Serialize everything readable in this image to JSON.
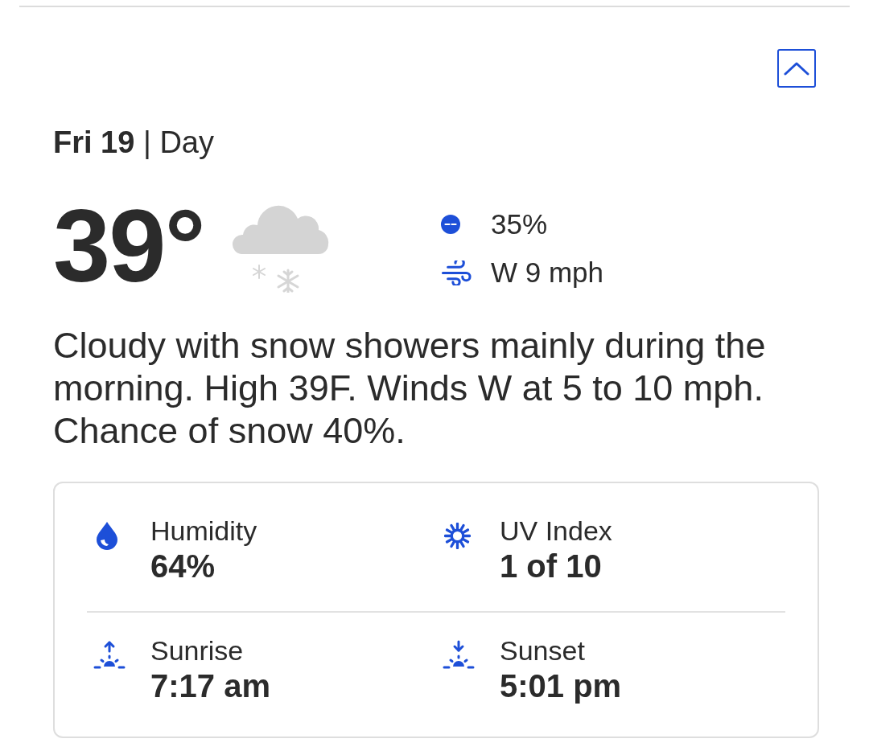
{
  "collapse_button": {
    "expanded": true
  },
  "header": {
    "title": "**Fri 19** | Day"
  },
  "current": {
    "temperature": "39°"
  },
  "stats": [
    {
      "kind": "precipitation",
      "value": "35%"
    },
    {
      "kind": "wind",
      "value": "W 9 mph"
    }
  ],
  "description": "Cloudy with snow showers mainly during the morning. High 39F. Winds W at 5 to 10 mph. Chance of snow 40%.",
  "details": [
    {
      "kind": "humidity",
      "label": "Humidity",
      "value": "64%"
    },
    {
      "kind": "uv",
      "label": "UV Index",
      "value": "1 of 10"
    },
    {
      "kind": "sunrise",
      "label": "Sunrise",
      "value": "7:17 am"
    },
    {
      "kind": "sunset",
      "label": "Sunset",
      "value": "5:01 pm"
    }
  ]
}
